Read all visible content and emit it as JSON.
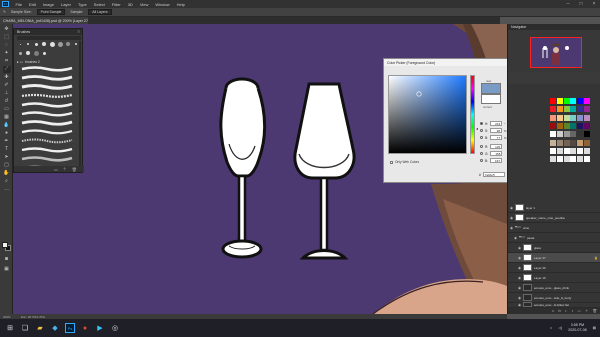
{
  "app": {
    "menu": [
      "File",
      "Edit",
      "Image",
      "Layer",
      "Type",
      "Select",
      "Filter",
      "3D",
      "View",
      "Window",
      "Help"
    ],
    "options": {
      "tool_label": "Sample Size:",
      "sample_size": "Point Sample",
      "sample_label": "Sample:",
      "sample_value": "All Layers"
    },
    "doc_tab": "CHARA_MELONIA_(mf1428).psd @ 200% (Layer 27, RGB/8#)",
    "status": [
      "200%",
      "Doc: 28.7M/1.05G"
    ]
  },
  "brushes_panel": {
    "title": "Brushes",
    "folder": "brushes 2"
  },
  "color_picker": {
    "title": "Color Picker (Foreground Color)",
    "new_label": "new",
    "current_label": "current",
    "buttons": [
      "OK",
      "Cancel",
      "Add to Swatches",
      "Color Libraries"
    ],
    "only_web_colors": "Only Web Colors",
    "hsb": [
      {
        "label": "H:",
        "value": "213",
        "unit": "°"
      },
      {
        "label": "S:",
        "value": "38",
        "unit": "%"
      },
      {
        "label": "B:",
        "value": "77",
        "unit": "%"
      }
    ],
    "rgb": [
      {
        "label": "R:",
        "value": "122"
      },
      {
        "label": "G:",
        "value": "155"
      },
      {
        "label": "B:",
        "value": "197"
      }
    ],
    "lab": [
      {
        "label": "L:",
        "value": "63"
      },
      {
        "label": "a:",
        "value": "-1"
      },
      {
        "label": "b:",
        "value": "-27"
      }
    ],
    "cmyk": [
      {
        "label": "C:",
        "value": "54",
        "unit": "%"
      },
      {
        "label": "M:",
        "value": "34",
        "unit": "%"
      },
      {
        "label": "Y:",
        "value": "10",
        "unit": "%"
      },
      {
        "label": "K:",
        "value": "0",
        "unit": "%"
      }
    ],
    "hex_label": "#",
    "hex": "7a9bc5",
    "new_color": "#7a9bc5",
    "current_color": "#ffffff"
  },
  "navigator": {
    "title": "Navigator"
  },
  "layers": {
    "rows": [
      {
        "name": "layer 1",
        "thumb": "white"
      },
      {
        "name": "speaker_name_cute_poetika",
        "thumb": "white"
      },
      {
        "name": "wine",
        "thumb": "folder"
      },
      {
        "name": "pasta",
        "thumb": "folder"
      },
      {
        "name": "glass",
        "thumb": "white"
      },
      {
        "name": "Layer 27",
        "thumb": "white",
        "selected": true
      },
      {
        "name": "Layer 26",
        "thumb": "white"
      },
      {
        "name": "Layer 16",
        "thumb": "white"
      },
      {
        "name": "emotes_emo...glass_drink",
        "thumb": "dark"
      },
      {
        "name": "emotes_emo...side_&_body",
        "thumb": "dark"
      },
      {
        "name": "emotes_emo...& follow list",
        "thumb": "dark"
      }
    ]
  },
  "taskbar": {
    "time": "3:55 PM",
    "date": "2020-07-08"
  },
  "canvas_color": "#4d3972"
}
